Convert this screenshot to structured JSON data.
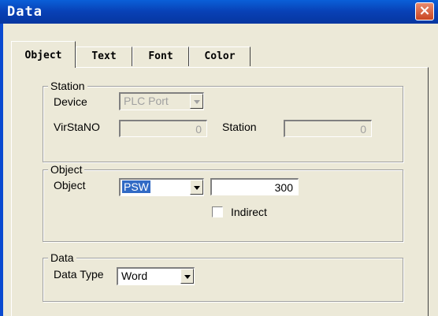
{
  "window": {
    "title": "Data",
    "close_label": "×"
  },
  "tabs": [
    "Object",
    "Text",
    "Font",
    "Color"
  ],
  "station_group": {
    "legend": "Station",
    "device_label": "Device",
    "device_value": "PLC Port",
    "virstano_label": "VirStaNO",
    "virstano_value": "0",
    "station_label": "Station",
    "station_value": "0"
  },
  "object_group": {
    "legend": "Object",
    "object_label": "Object",
    "object_type": "PSW",
    "object_address": "300",
    "indirect_label": "Indirect",
    "indirect_checked": false
  },
  "data_group": {
    "legend": "Data",
    "data_type_label": "Data Type",
    "data_type_value": "Word"
  },
  "colors": {
    "title_bar": "#0840b5",
    "selection": "#316ac5",
    "dialog_bg": "#ece9d8"
  }
}
